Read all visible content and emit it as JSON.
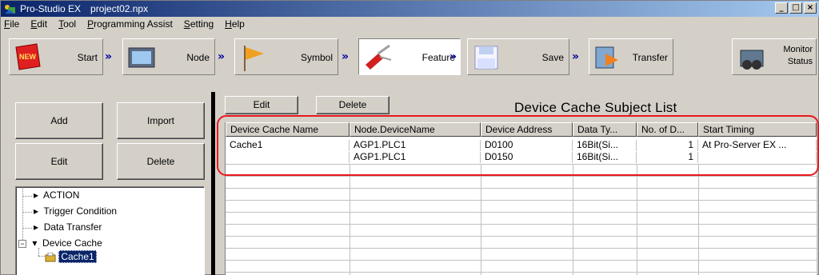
{
  "window": {
    "app_title": "Pro-Studio EX",
    "file_name": "project02.npx",
    "controls": [
      "_",
      "□",
      "×"
    ]
  },
  "menu": [
    {
      "pre": "",
      "ul": "F",
      "post": "ile"
    },
    {
      "pre": "",
      "ul": "E",
      "post": "dit"
    },
    {
      "pre": "",
      "ul": "T",
      "post": "ool"
    },
    {
      "pre": "",
      "ul": "P",
      "post": "rogramming Assist"
    },
    {
      "pre": "",
      "ul": "S",
      "post": "etting"
    },
    {
      "pre": "",
      "ul": "H",
      "post": "elp"
    }
  ],
  "toolbar": {
    "start": "Start",
    "node": "Node",
    "symbol": "Symbol",
    "feature": "Feature",
    "save": "Save",
    "transfer": "Transfer",
    "monitor_line1": "Monitor",
    "monitor_line2": "Status",
    "new_badge": "NEW",
    "chevron": "»"
  },
  "left": {
    "add": "Add",
    "import": "Import",
    "edit": "Edit",
    "delete": "Delete",
    "tree": {
      "action": "ACTION",
      "trigger_condition": "Trigger Condition",
      "data_transfer": "Data Transfer",
      "device_cache": "Device Cache",
      "cache1": "Cache1"
    }
  },
  "right": {
    "edit": "Edit",
    "delete": "Delete",
    "list_title": "Device Cache Subject List",
    "columns": [
      "Device Cache Name",
      "Node.DeviceName",
      "Device Address",
      "Data Ty...",
      "No. of D...",
      "Start Timing"
    ],
    "rows": [
      [
        "Cache1",
        "AGP1.PLC1",
        "D0100",
        "16Bit(Si...",
        "1",
        "At Pro-Server EX ..."
      ],
      [
        "",
        "AGP1.PLC1",
        "D0150",
        "16Bit(Si...",
        "1",
        ""
      ]
    ]
  },
  "colors": {
    "highlight": "#e8181c",
    "title_bar": "#0a246a",
    "selection": "#0a246a"
  }
}
